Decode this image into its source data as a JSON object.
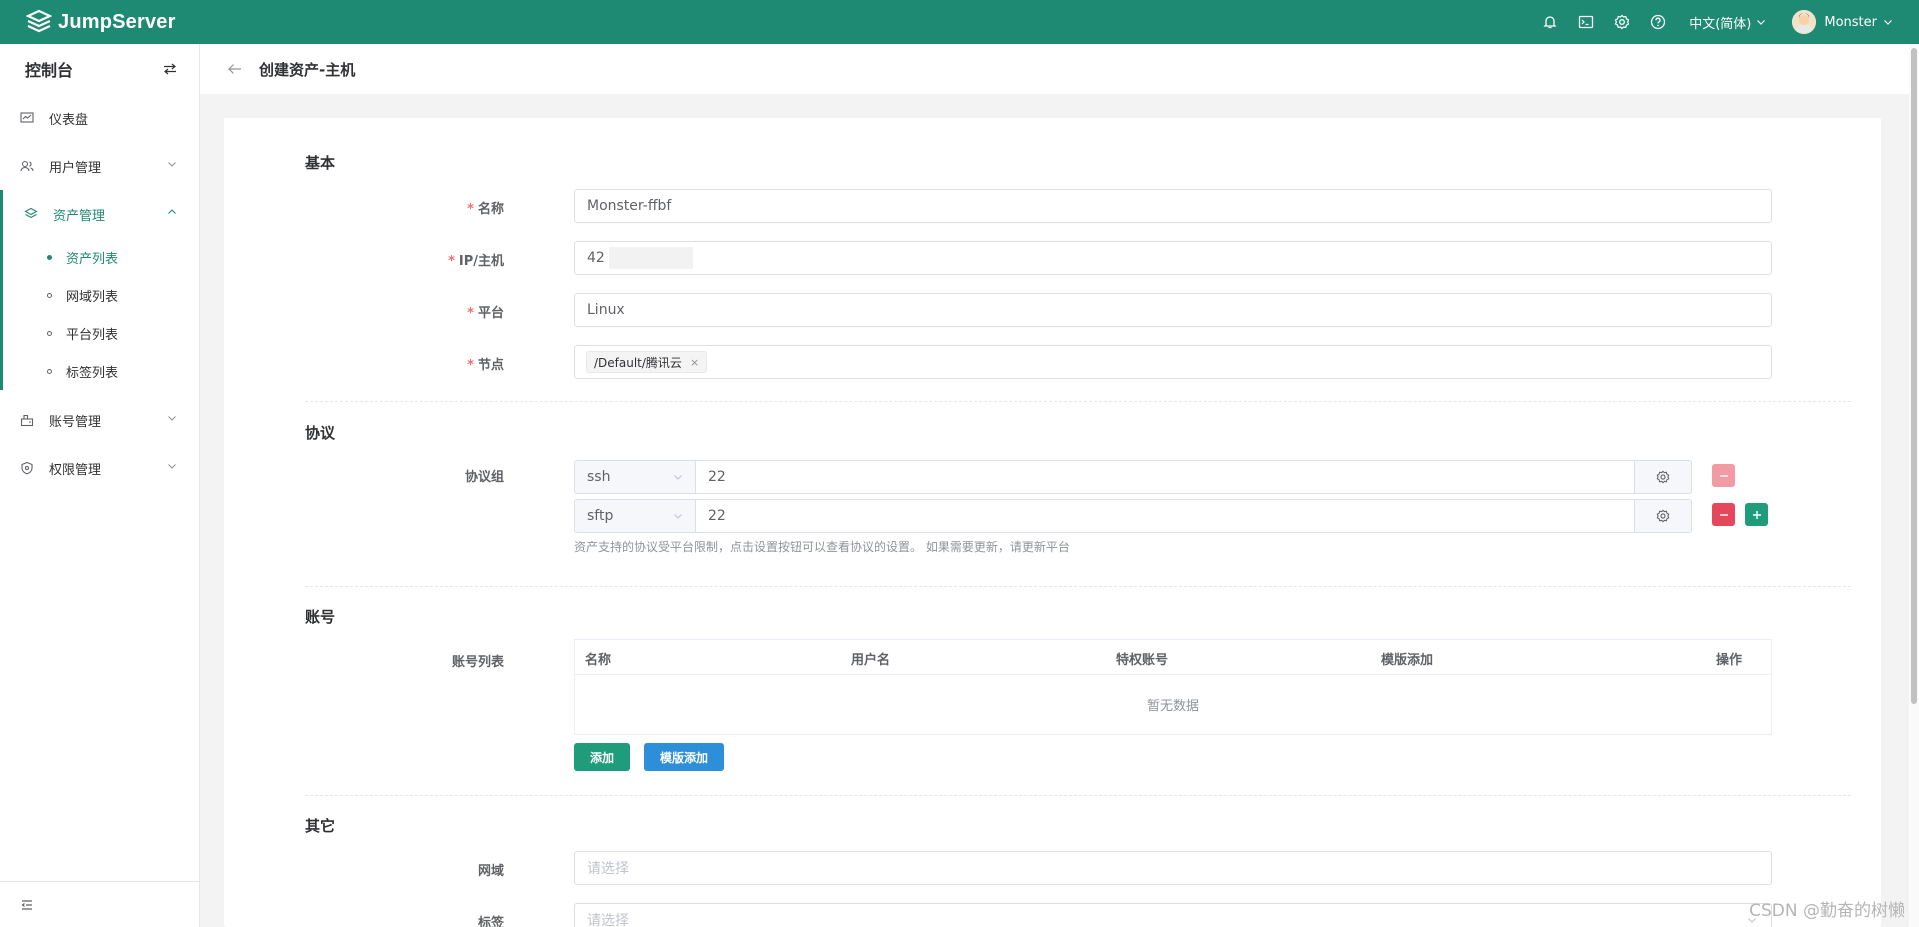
{
  "topbar": {
    "brand": "JumpServer",
    "icons": [
      "bell-icon",
      "terminal-icon",
      "settings-icon",
      "help-icon"
    ],
    "language": "中文(简体)",
    "username": "Monster",
    "color": "#1f8a73"
  },
  "sidebar": {
    "title": "控制台",
    "items": [
      {
        "label": "仪表盘",
        "icon": "dashboard-icon"
      },
      {
        "label": "用户管理",
        "icon": "users-icon"
      },
      {
        "label": "资产管理",
        "icon": "layers-icon"
      },
      {
        "label": "账号管理",
        "icon": "accounts-icon"
      },
      {
        "label": "权限管理",
        "icon": "shield-icon"
      }
    ],
    "asset_sub": [
      "资产列表",
      "网域列表",
      "平台列表",
      "标签列表"
    ]
  },
  "page": {
    "title": "创建资产-主机"
  },
  "form": {
    "basic": {
      "title": "基本",
      "name_label": "名称",
      "name_value": "Monster-ffbf",
      "ip_label": "IP/主机",
      "ip_value": "42",
      "platform_label": "平台",
      "platform_value": "Linux",
      "node_label": "节点",
      "node_tag": "/Default/腾讯云",
      "node_tag_close": "×"
    },
    "protocol": {
      "title": "协议",
      "group_label": "协议组",
      "rows": [
        {
          "name": "ssh",
          "port": "22"
        },
        {
          "name": "sftp",
          "port": "22"
        }
      ],
      "hint": "资产支持的协议受平台限制，点击设置按钮可以查看协议的设置。 如果需要更新，请更新平台"
    },
    "account": {
      "title": "账号",
      "list_label": "账号列表",
      "columns": [
        "名称",
        "用户名",
        "特权账号",
        "模版添加",
        "操作"
      ],
      "empty_text": "暂无数据",
      "add_button": "添加",
      "template_button": "模版添加"
    },
    "other": {
      "title": "其它",
      "domain_label": "网域",
      "domain_placeholder": "请选择",
      "labels_label": "标签",
      "labels_placeholder": "请选择"
    }
  },
  "watermark": "CSDN @勤奋的树懒"
}
